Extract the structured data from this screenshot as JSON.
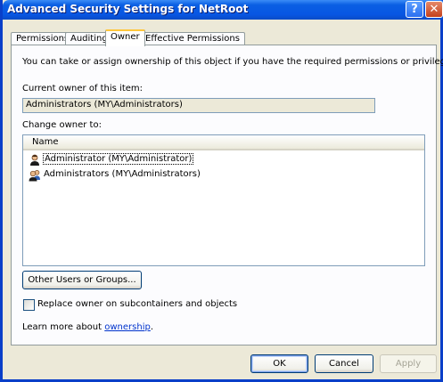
{
  "window": {
    "title": "Advanced Security Settings for NetRoot"
  },
  "titlebar_buttons": {
    "help": "?",
    "close": "✕"
  },
  "tabs": [
    {
      "label": "Permissions",
      "active": false
    },
    {
      "label": "Auditing",
      "active": false
    },
    {
      "label": "Owner",
      "active": true
    },
    {
      "label": "Effective Permissions",
      "active": false
    }
  ],
  "owner_tab": {
    "intro": "You can take or assign ownership of this object if you have the required permissions or privileges.",
    "current_owner_label": "Current owner of this item:",
    "current_owner_value": "Administrators (MY\\Administrators)",
    "change_owner_label": "Change owner to:",
    "list_header_name": "Name",
    "list_items": [
      {
        "label": "Administrator (MY\\Administrator)",
        "icon": "user-icon",
        "focused": true
      },
      {
        "label": "Administrators (MY\\Administrators)",
        "icon": "group-icon",
        "focused": false
      }
    ],
    "other_users_button": "Other Users or Groups...",
    "replace_checkbox_label": "Replace owner on subcontainers and objects",
    "replace_checked": false,
    "learn_more_prefix": "Learn more about ",
    "learn_more_link": "ownership",
    "learn_more_suffix": "."
  },
  "footer": {
    "ok": "OK",
    "cancel": "Cancel",
    "apply": "Apply"
  }
}
